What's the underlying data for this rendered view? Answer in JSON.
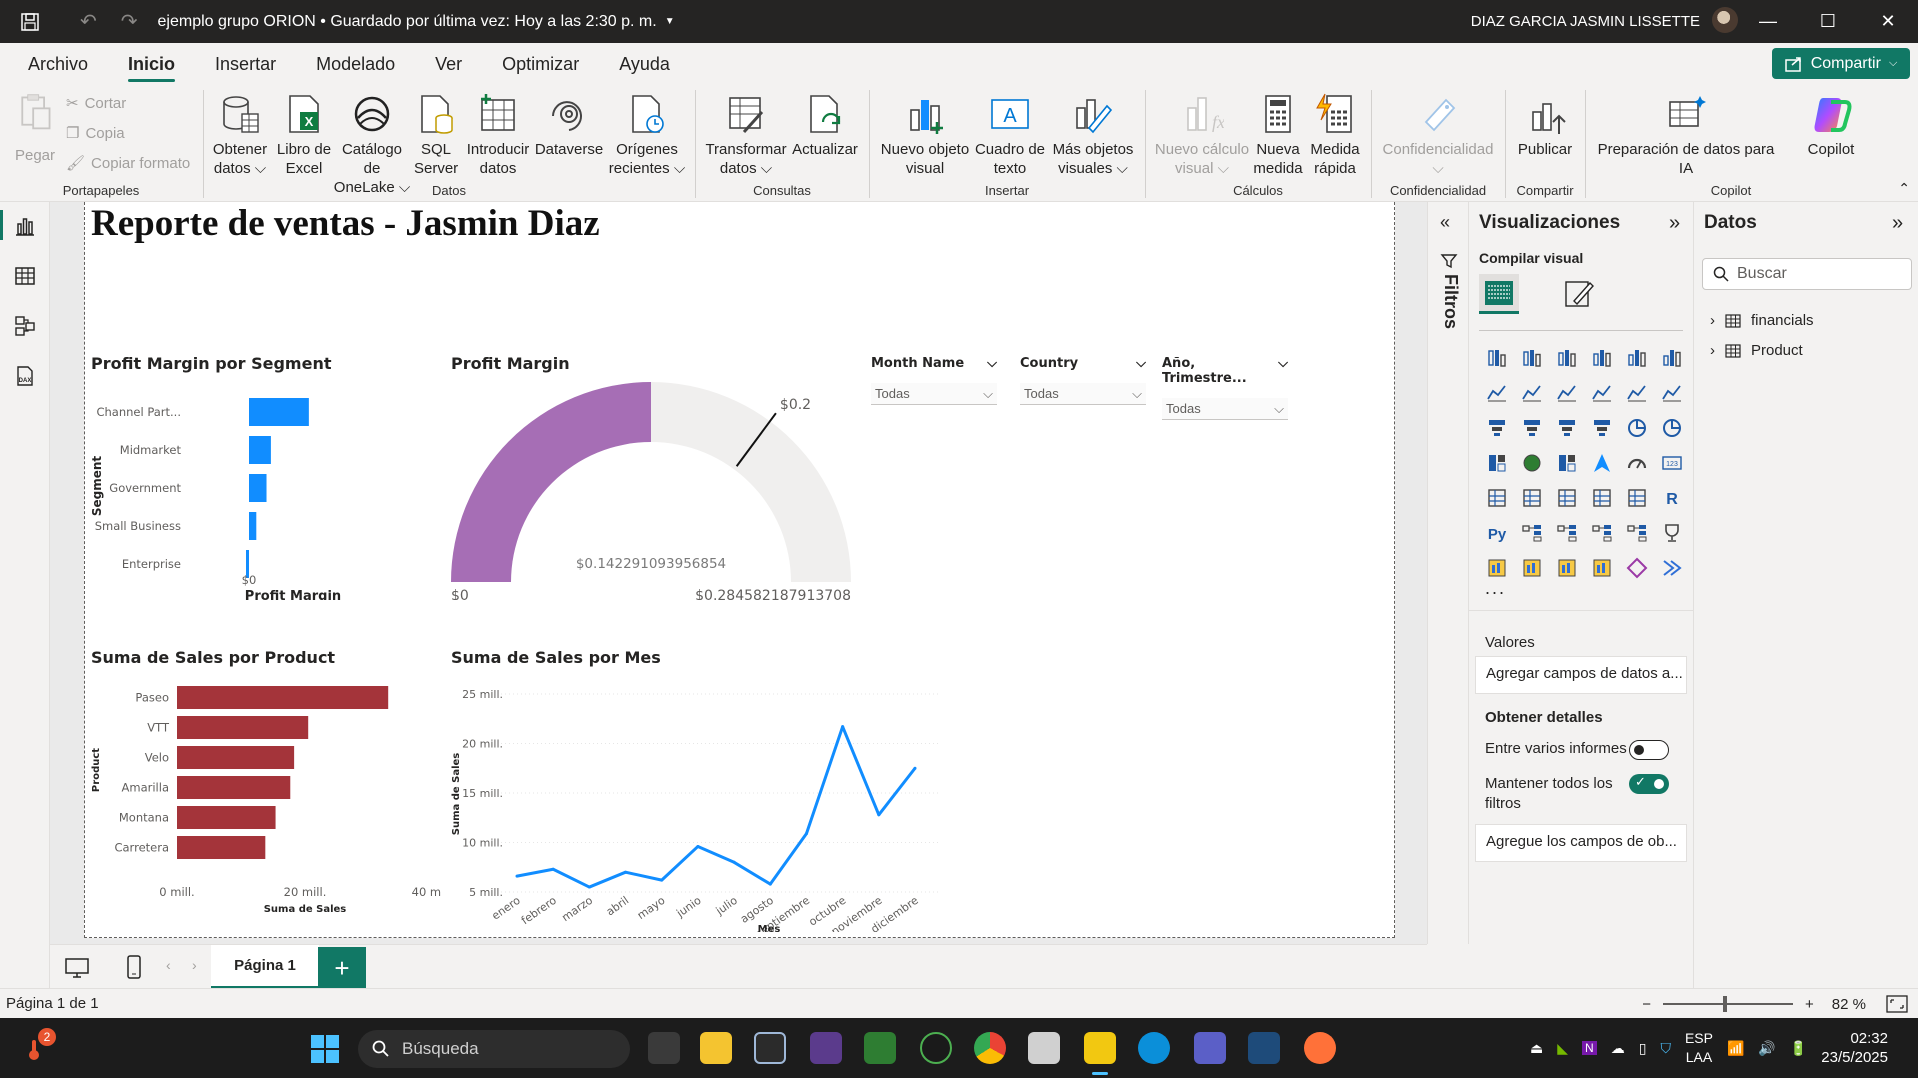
{
  "titlebar": {
    "doc_title": "ejemplo grupo ORION • Guardado por última vez: Hoy a las 2:30 p. m.",
    "user": "DIAZ GARCIA JASMIN LISSETTE"
  },
  "menu": {
    "tabs": [
      "Archivo",
      "Inicio",
      "Insertar",
      "Modelado",
      "Ver",
      "Optimizar",
      "Ayuda"
    ],
    "share_label": "Compartir"
  },
  "ribbon": {
    "portapapeles": {
      "label": "Portapapeles",
      "paste": "Pegar",
      "cut": "Cortar",
      "copy": "Copia",
      "format": "Copiar formato"
    },
    "datos": {
      "label": "Datos",
      "get_data": [
        "Obtener",
        "datos"
      ],
      "excel": [
        "Libro de",
        "Excel"
      ],
      "onelake": [
        "Catálogo de",
        "OneLake"
      ],
      "sql": [
        "SQL",
        "Server"
      ],
      "enter": [
        "Introducir",
        "datos"
      ],
      "dataverse": [
        "Dataverse",
        ""
      ],
      "recent": [
        "Orígenes",
        "recientes"
      ]
    },
    "consultas": {
      "label": "Consultas",
      "transform": [
        "Transformar",
        "datos"
      ],
      "refresh": [
        "Actualizar",
        ""
      ]
    },
    "insertar": {
      "label": "Insertar",
      "new_visual": [
        "Nuevo objeto",
        "visual"
      ],
      "textbox": [
        "Cuadro de",
        "texto"
      ],
      "more": [
        "Más objetos",
        "visuales"
      ]
    },
    "calculos": {
      "label": "Cálculos",
      "new_calc": [
        "Nuevo cálculo",
        "visual"
      ],
      "new_measure": [
        "Nueva",
        "medida"
      ],
      "quick": [
        "Medida",
        "rápida"
      ]
    },
    "confidencialidad": {
      "label": "Confidencialidad",
      "btn": "Confidencialidad"
    },
    "compartir": {
      "label": "Compartir",
      "publish": "Publicar"
    },
    "copilot": {
      "label": "Copilot",
      "prep": [
        "Preparación de datos para",
        "IA"
      ],
      "copilot": "Copilot"
    }
  },
  "report": {
    "title": "Reporte de  ventas - Jasmin Diaz",
    "pm_segment": {
      "title": "Profit Margin por Segment"
    },
    "gauge": {
      "title": "Profit Margin"
    },
    "sales_product": {
      "title": "Suma de Sales por Product"
    },
    "sales_month": {
      "title": "Suma de Sales por Mes"
    },
    "slicers": [
      {
        "label": "Month Name",
        "value": "Todas"
      },
      {
        "label": "Country",
        "value": "Todas"
      },
      {
        "label": "Año, Trimestre...",
        "value": "Todas"
      }
    ]
  },
  "chart_data": [
    {
      "type": "bar",
      "title": "Profit Margin por Segment",
      "categories": [
        "Channel Part...",
        "Midmarket",
        "Government",
        "Small Business",
        "Enterprise"
      ],
      "values": [
        0.41,
        0.15,
        0.12,
        0.05,
        -0.01
      ],
      "xlabel": "Profit Margin",
      "ylabel": "Segment",
      "x_ticks": [
        "$0",
        "$1"
      ],
      "color": "#118DFF"
    },
    {
      "type": "gauge",
      "title": "Profit Margin",
      "value": 0.142291093956854,
      "value_label": "$0.142291093956854",
      "min": 0,
      "min_label": "$0",
      "max": 0.284582187913708,
      "max_label": "$0.284582187913708",
      "target": 0.2,
      "target_label": "$0.2",
      "color": "#A66EB5"
    },
    {
      "type": "bar",
      "title": "Suma de Sales por Product",
      "categories": [
        "Paseo",
        "VTT",
        "Velo",
        "Amarilla",
        "Montana",
        "Carretera"
      ],
      "values": [
        33.0,
        20.5,
        18.3,
        17.7,
        15.4,
        13.8
      ],
      "xlabel": "Suma de Sales",
      "ylabel": "Product",
      "x_ticks": [
        "0 mill.",
        "20 mill.",
        "40 mill."
      ],
      "xlim": [
        0,
        40
      ],
      "unit": "mill.",
      "color": "#A4343A"
    },
    {
      "type": "line",
      "title": "Suma de Sales por Mes",
      "categories": [
        "enero",
        "febrero",
        "marzo",
        "abril",
        "mayo",
        "junio",
        "julio",
        "agosto",
        "septiembre",
        "octubre",
        "noviembre",
        "diciembre"
      ],
      "values": [
        6.6,
        7.3,
        5.5,
        7.0,
        6.2,
        9.6,
        8.0,
        5.8,
        10.9,
        21.7,
        12.8,
        17.5
      ],
      "xlabel": "Mes",
      "ylabel": "Suma de Sales",
      "y_ticks": [
        "5 mill.",
        "10 mill.",
        "15 mill.",
        "20 mill.",
        "25 mill."
      ],
      "ylim": [
        5,
        25
      ],
      "unit": "mill.",
      "color": "#118DFF"
    }
  ],
  "pages": {
    "current": "Página 1",
    "status": "Página 1 de 1"
  },
  "filters": {
    "label": "Filtros"
  },
  "viz_pane": {
    "title": "Visualizaciones",
    "build": "Compilar visual",
    "values_label": "Valores",
    "values_placeholder": "Agregar campos de datos a...",
    "details_label": "Obtener detalles",
    "cross_report": "Entre varios informes",
    "keep_filters": [
      "Mantener todos los",
      "filtros"
    ],
    "drill_placeholder": "Agregue los campos de ob...",
    "more": "..."
  },
  "data_pane": {
    "title": "Datos",
    "search_placeholder": "Buscar",
    "tables": [
      "financials",
      "Product"
    ]
  },
  "statusbar": {
    "zoom": "82 %"
  },
  "taskbar": {
    "search": "Búsqueda",
    "lang": [
      "ESP",
      "LAA"
    ],
    "time": "02:32",
    "date": "23/5/2025",
    "badge": "2"
  }
}
